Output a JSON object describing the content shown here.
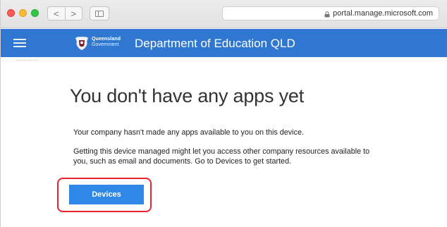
{
  "browser": {
    "nav_back": "<",
    "nav_forward": ">",
    "address": "portal.manage.microsoft.com"
  },
  "header": {
    "logo_line1": "Queensland",
    "logo_line2": "Government",
    "title": "Department of Education QLD",
    "color": "#2f77d0"
  },
  "main": {
    "heading": "You don't have any apps yet",
    "paragraph1": "Your company hasn't made any apps available to you on this device.",
    "paragraph2": "Getting this device managed might let you access other company resources available to you, such as email and documents. Go to Devices to get started.",
    "devices_button": "Devices",
    "button_color": "#2f87e8",
    "highlight_color": "#e8222c"
  },
  "icons": {
    "menu": "hamburger-icon",
    "lock": "lock-icon",
    "logo": "crest-icon",
    "sidebar": "sidebar-toggle-icon"
  }
}
